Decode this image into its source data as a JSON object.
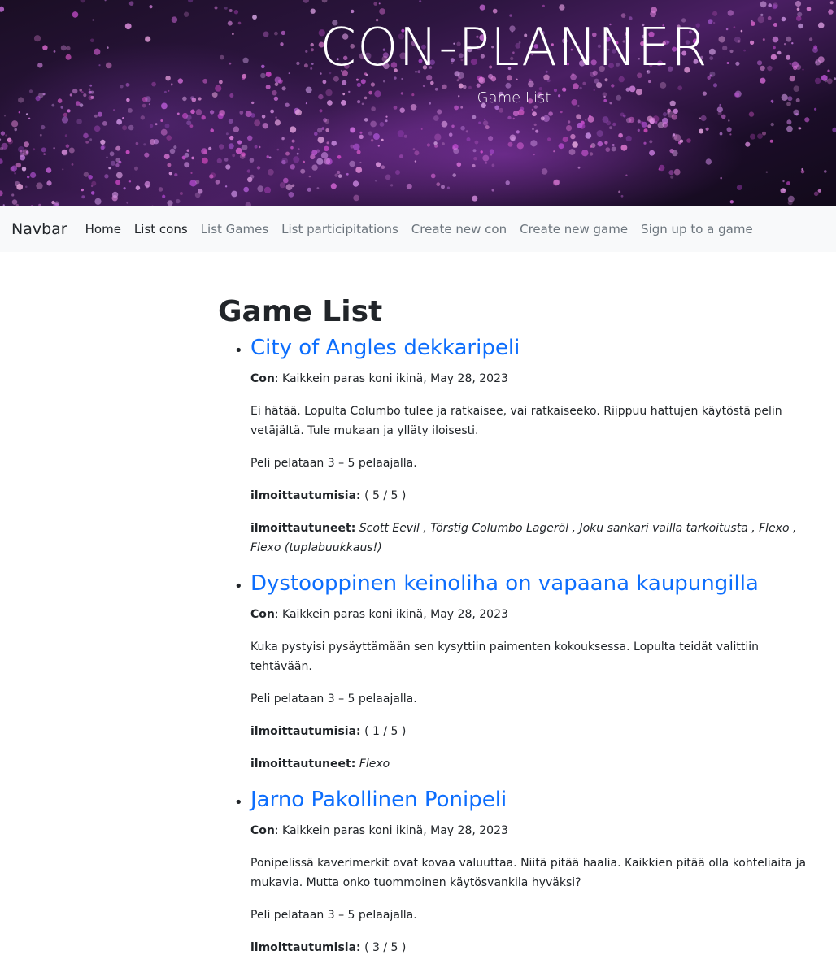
{
  "header": {
    "title": "CON-PLANNER",
    "subtitle": "Game List"
  },
  "navbar": {
    "brand": "Navbar",
    "links": [
      {
        "label": "Home"
      },
      {
        "label": "List cons"
      },
      {
        "label": "List Games"
      },
      {
        "label": "List participitations"
      },
      {
        "label": "Create new con"
      },
      {
        "label": "Create new game"
      },
      {
        "label": "Sign up to a game"
      }
    ]
  },
  "main": {
    "title": "Game List",
    "labels": {
      "con": "Con",
      "signups": "ilmoittautumisia:",
      "participants": "ilmoittautuneet:"
    },
    "games": [
      {
        "title": "City of Angles dekkaripeli",
        "con": ": Kaikkein paras koni ikinä, May 28, 2023",
        "description": "Ei hätää. Lopulta Columbo tulee ja ratkaisee, vai ratkaiseeko. Riippuu hattujen käytöstä pelin vetäjältä. Tule mukaan ja ylläty iloisesti.",
        "players": "Peli pelataan 3 – 5 pelaajalla.",
        "signups": " ( 5 / 5 )",
        "participants": "Scott Eevil , Törstig Columbo Lageröl , Joku sankari vailla tarkoitusta , Flexo , Flexo (tuplabuukkaus!)"
      },
      {
        "title": "Dystooppinen keinoliha on vapaana kaupungilla",
        "con": ": Kaikkein paras koni ikinä, May 28, 2023",
        "description": "Kuka pystyisi pysäyttämään sen kysyttiin paimenten kokouksessa. Lopulta teidät valittiin tehtävään.",
        "players": "Peli pelataan 3 – 5 pelaajalla.",
        "signups": " ( 1 / 5 )",
        "participants": "Flexo"
      },
      {
        "title": "Jarno Pakollinen Ponipeli",
        "con": ": Kaikkein paras koni ikinä, May 28, 2023",
        "description": "Ponipelissä kaverimerkit ovat kovaa valuuttaa. Niitä pitää haalia. Kaikkien pitää olla kohteliaita ja mukavia. Mutta onko tuommoinen käytösvankila hyväksi?",
        "players": "Peli pelataan 3 – 5 pelaajalla.",
        "signups": " ( 3 / 5 )"
      }
    ]
  }
}
